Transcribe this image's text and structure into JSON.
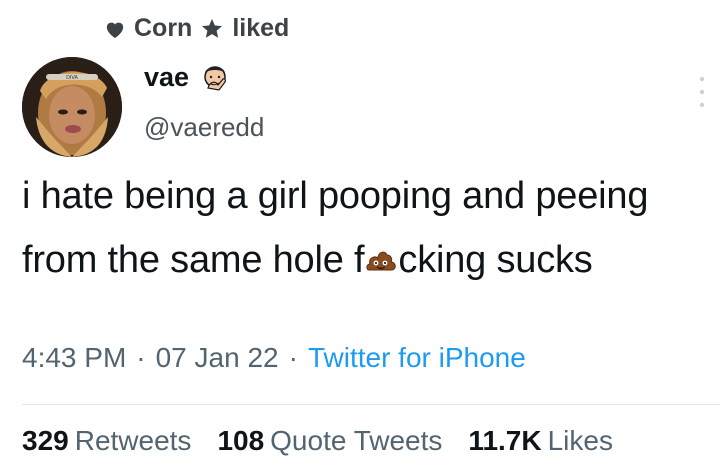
{
  "social_context": {
    "user": "Corn",
    "action": "liked",
    "icon": "heart-icon",
    "star_icon": "star-icon"
  },
  "author": {
    "display_name": "vae",
    "name_emoji": "face-with-hand-icon",
    "handle": "@vaeredd",
    "avatar_icon": "avatar"
  },
  "tweet": {
    "text_before": "i hate being a girl pooping and peeing from the same hole f",
    "inline_emoji": "poop-icon",
    "text_after": "cking sucks"
  },
  "meta": {
    "time": "4:43 PM",
    "date": "07 Jan 22",
    "source": "Twitter for iPhone"
  },
  "stats": {
    "retweets_count": "329",
    "retweets_label": "Retweets",
    "quotes_count": "108",
    "quotes_label": "Quote Tweets",
    "likes_count": "11.7K",
    "likes_label": "Likes"
  },
  "colors": {
    "text": "#0f1419",
    "muted": "#536471",
    "link": "#1d9bf0"
  }
}
